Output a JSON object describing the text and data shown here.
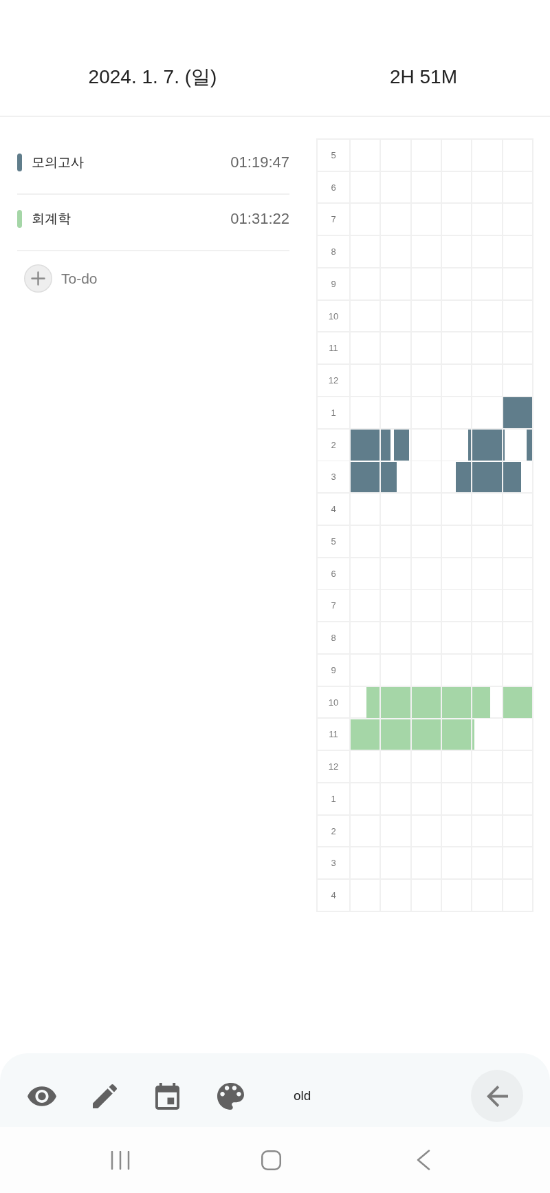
{
  "header": {
    "date": "2024. 1. 7. (일)",
    "total": "2H 51M"
  },
  "subjects": [
    {
      "name": "모의고사",
      "time": "01:19:47",
      "color": "#607d8b"
    },
    {
      "name": "회계학",
      "time": "01:31:22",
      "color": "#a5d6a7"
    }
  ],
  "add_todo": {
    "label": "To-do"
  },
  "timetable": {
    "hours": [
      "5",
      "6",
      "7",
      "8",
      "9",
      "10",
      "11",
      "12",
      "1",
      "2",
      "3",
      "4",
      "5",
      "6",
      "7",
      "8",
      "9",
      "10",
      "11",
      "12",
      "1",
      "2",
      "3",
      "4"
    ]
  },
  "toolbar": {
    "mode_label": "old"
  }
}
